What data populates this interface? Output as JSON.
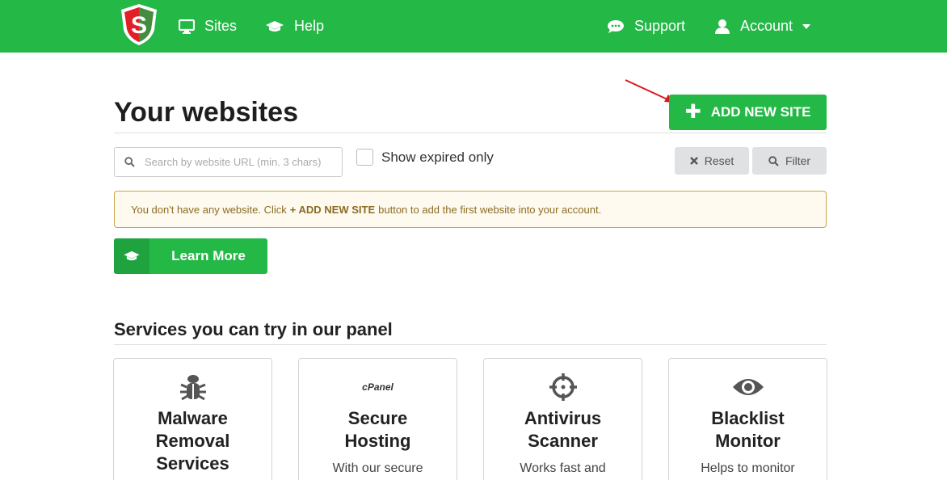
{
  "header": {
    "nav": [
      {
        "label": "Sites",
        "icon": "monitor-icon"
      },
      {
        "label": "Help",
        "icon": "graduation-cap-icon"
      },
      {
        "label": "Support",
        "icon": "chat-bubble-icon"
      },
      {
        "label": "Account",
        "icon": "user-icon"
      }
    ],
    "brand_color": "#24b847",
    "logo_letter": "S"
  },
  "main": {
    "title": "Your websites",
    "add_button_label": "ADD NEW SITE",
    "search_placeholder": "Search by website URL (min. 3 chars)",
    "show_expired_label": "Show expired only",
    "reset_label": "Reset",
    "filter_label": "Filter",
    "alert": {
      "before": "You don't have any website. Click",
      "highlight": "+ ADD NEW SITE",
      "after": "button to add the first website into your account."
    },
    "learn_more_label": "Learn More"
  },
  "services": {
    "title": "Services you can try in our panel",
    "cards": [
      {
        "icon": "bug-icon",
        "title": "Malware Removal Services",
        "desc": ""
      },
      {
        "icon": "cpanel-icon",
        "icon_text": "cPanel",
        "title": "Secure Hosting",
        "desc": "With our secure hosting packages you"
      },
      {
        "icon": "crosshair-icon",
        "title": "Antivirus Scanner",
        "desc": "Works fast and"
      },
      {
        "icon": "eye-icon",
        "title": "Blacklist Monitor",
        "desc": "Helps to monitor"
      }
    ]
  },
  "colors": {
    "accent": "#24b847",
    "alert_bg": "#fffaf0",
    "alert_border": "#c9a34a",
    "annotation_arrow": "#e0151a"
  }
}
